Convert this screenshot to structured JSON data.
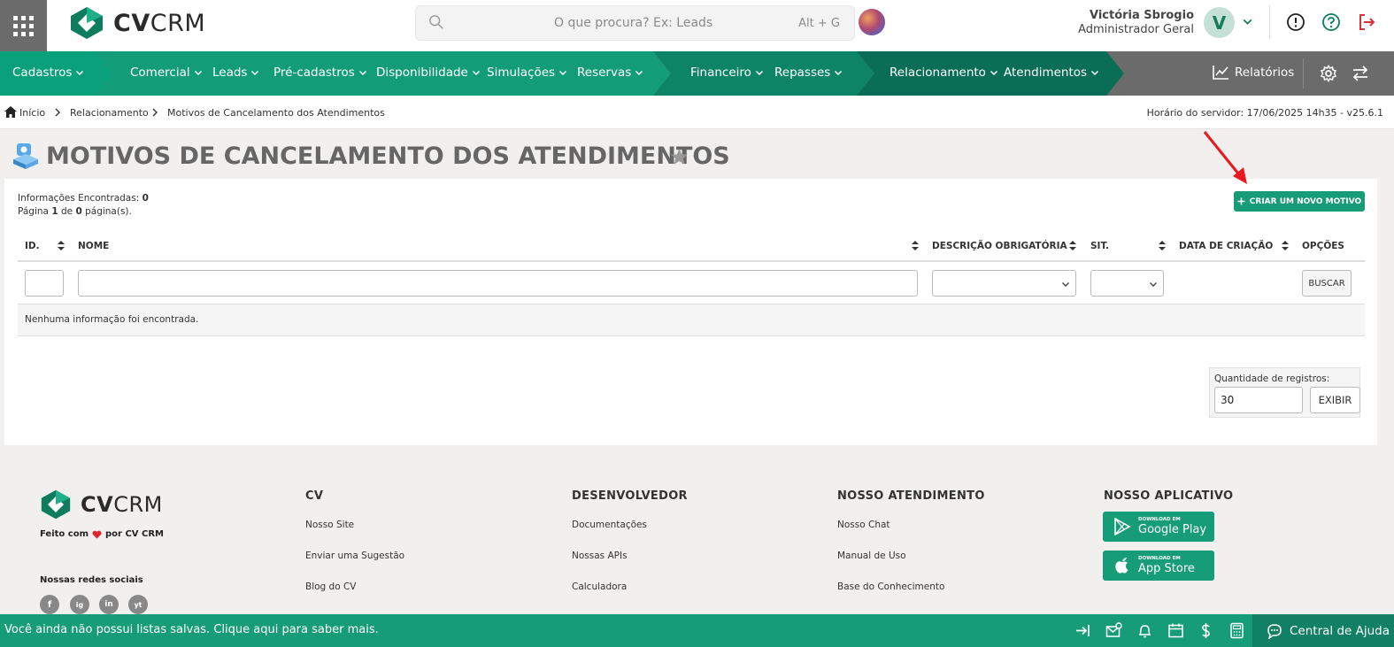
{
  "topbar": {
    "logo": {
      "brand_bold": "CV",
      "brand_light": "CRM"
    },
    "search": {
      "placeholder": "O que procura? Ex: Leads",
      "shortcut": "Alt + G"
    },
    "user": {
      "name": "Victória Sbrogio",
      "role": "Administrador Geral",
      "initial": "V"
    },
    "icons": [
      "apps-grid-icon",
      "search-icon",
      "info-icon",
      "help-icon",
      "logout-icon"
    ]
  },
  "nav": {
    "items": [
      {
        "label": "Cadastros"
      },
      {
        "label": "Comercial"
      },
      {
        "label": "Leads"
      },
      {
        "label": "Pré-cadastros"
      },
      {
        "label": "Disponibilidade"
      },
      {
        "label": "Simulações"
      },
      {
        "label": "Reservas"
      },
      {
        "label": "Financeiro"
      },
      {
        "label": "Repasses"
      },
      {
        "label": "Relacionamento"
      },
      {
        "label": "Atendimentos"
      }
    ],
    "reports_label": "Relatórios",
    "colors": {
      "cadastros": "#0aa07c",
      "comercial": "#139c78",
      "financeiro": "#0e8466",
      "relacionamento": "#0a6d55",
      "gray": "#6b6b6b"
    }
  },
  "breadcrumb": {
    "items": [
      "Início",
      "Relacionamento",
      "Motivos de Cancelamento dos Atendimentos"
    ],
    "server_time": "Horário do servidor: 17/06/2025 14h35 - v25.6.1"
  },
  "page": {
    "title": "MOTIVOS DE CANCELAMENTO DOS ATENDIMENTOS",
    "info_found_label": "Informações Encontradas:",
    "info_found_value": "0",
    "page_label": "Página",
    "page_current": "1",
    "page_of": "de",
    "page_total": "0",
    "page_suffix": "página(s).",
    "create_button": "CRIAR UM NOVO MOTIVO"
  },
  "table": {
    "columns": [
      "ID.",
      "NOME",
      "DESCRIÇÃO OBRIGATÓRIA",
      "SIT.",
      "DATA DE CRIAÇÃO",
      "OPÇÕES"
    ],
    "filters": {
      "id": "",
      "nome": "",
      "descricao": "",
      "sit": ""
    },
    "search_button": "BUSCAR",
    "empty_message": "Nenhuma informação foi encontrada."
  },
  "pagination": {
    "qty_label": "Quantidade de registros:",
    "qty_value": "30",
    "show_button": "EXIBIR"
  },
  "footer": {
    "made_prefix": "Feito com",
    "made_suffix": "por CV CRM",
    "social_title": "Nossas redes sociais",
    "social": [
      "f",
      "ig",
      "in",
      "yt"
    ],
    "columns": [
      {
        "title": "CV",
        "links": [
          "Nosso Site",
          "Enviar uma Sugestão",
          "Blog do CV"
        ]
      },
      {
        "title": "DESENVOLVEDOR",
        "links": [
          "Documentações",
          "Nossas APIs",
          "Calculadora"
        ]
      },
      {
        "title": "NOSSO ATENDIMENTO",
        "links": [
          "Nosso Chat",
          "Manual de Uso",
          "Base do Conhecimento"
        ]
      },
      {
        "title": "NOSSO APLICATIVO",
        "links": []
      }
    ],
    "stores": [
      {
        "small": "DOWNLOAD EM",
        "big": "Google Play"
      },
      {
        "small": "DOWNLOAD EM",
        "big": "App Store"
      }
    ]
  },
  "bottombar": {
    "message": "Você ainda não possui listas salvas. Clique aqui para saber mais.",
    "help_label": "Central de Ajuda",
    "accent": "#179c78"
  }
}
